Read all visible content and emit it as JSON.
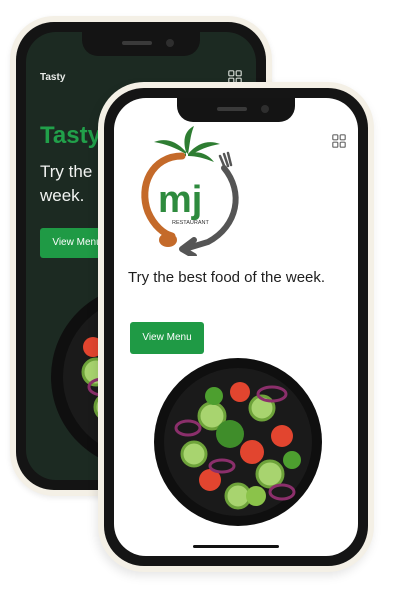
{
  "back_screen": {
    "brand": "Tasty",
    "title": "Tasty",
    "tagline": "Try the best food of the week.",
    "button_label": "View Menu"
  },
  "front_screen": {
    "logo_text": "mj",
    "logo_sub": "RESTAURANT",
    "tagline": "Try the best food of the week.",
    "button_label": "View Menu"
  },
  "colors": {
    "accent_green": "#1f9a45",
    "logo_orange": "#c46a2a",
    "dark_bg": "#1c2a22"
  },
  "icons": [
    "menu-grid-icon",
    "salad-plate-image",
    "restaurant-logo"
  ]
}
